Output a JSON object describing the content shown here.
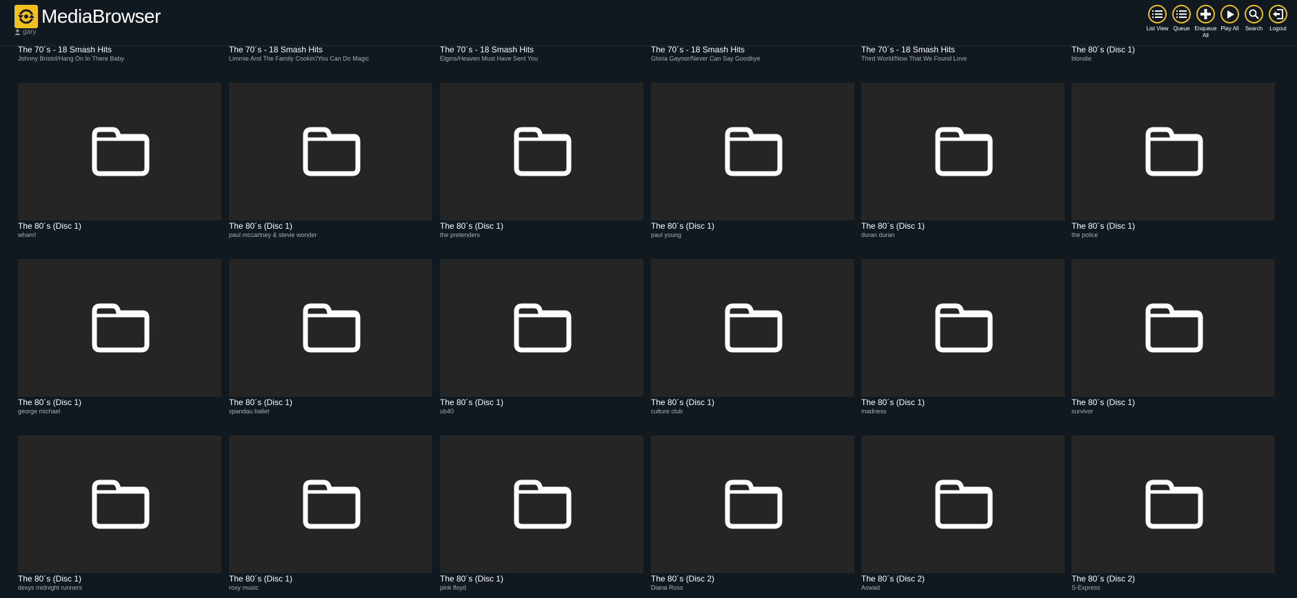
{
  "app": {
    "logo_word1": "Media",
    "logo_word2": "Browser",
    "user": "gary"
  },
  "toolbar": [
    {
      "label": "List View",
      "icon": "list-icon"
    },
    {
      "label": "Queue",
      "icon": "queue-icon"
    },
    {
      "label": "Enqueue All",
      "icon": "plus-icon"
    },
    {
      "label": "Play All",
      "icon": "play-icon"
    },
    {
      "label": "Search",
      "icon": "search-icon"
    },
    {
      "label": "Logout",
      "icon": "logout-icon"
    }
  ],
  "top_row": [
    {
      "title": "The 70´s - 18 Smash Hits",
      "sub": "Johnny Bristol/Hang On In There Baby"
    },
    {
      "title": "The 70´s - 18 Smash Hits",
      "sub": "Limmie And The Family Cookin'/You Can Do Magic"
    },
    {
      "title": "The 70´s - 18 Smash Hits",
      "sub": "Elgins/Heaven Must Have Sent You"
    },
    {
      "title": "The 70´s - 18 Smash Hits",
      "sub": "Gloria Gaynor/Never Can Say Goodbye"
    },
    {
      "title": "The 70´s - 18 Smash Hits",
      "sub": "Third World/Now That We Found Love"
    },
    {
      "title": "The 80´s (Disc 1)",
      "sub": "blondie"
    }
  ],
  "items": [
    {
      "title": "The 80´s (Disc 1)",
      "sub": "wham!"
    },
    {
      "title": "The 80´s (Disc 1)",
      "sub": "paul mccartney & stevie wonder"
    },
    {
      "title": "The 80´s (Disc 1)",
      "sub": "the pretenders"
    },
    {
      "title": "The 80´s (Disc 1)",
      "sub": "paul young"
    },
    {
      "title": "The 80´s (Disc 1)",
      "sub": "duran duran"
    },
    {
      "title": "The 80´s (Disc 1)",
      "sub": "the police"
    },
    {
      "title": "The 80´s (Disc 1)",
      "sub": "george michael"
    },
    {
      "title": "The 80´s (Disc 1)",
      "sub": "spandau ballet"
    },
    {
      "title": "The 80´s (Disc 1)",
      "sub": "ub40"
    },
    {
      "title": "The 80´s (Disc 1)",
      "sub": "culture club"
    },
    {
      "title": "The 80´s (Disc 1)",
      "sub": "madness"
    },
    {
      "title": "The 80´s (Disc 1)",
      "sub": "survivor"
    },
    {
      "title": "The 80´s (Disc 1)",
      "sub": "dexys midnight runners"
    },
    {
      "title": "The 80´s (Disc 1)",
      "sub": "roxy music"
    },
    {
      "title": "The 80´s (Disc 1)",
      "sub": "pink floyd"
    },
    {
      "title": "The 80´s (Disc 2)",
      "sub": "Diana Ross"
    },
    {
      "title": "The 80´s (Disc 2)",
      "sub": "Aswad"
    },
    {
      "title": "The 80´s (Disc 2)",
      "sub": "S-Express"
    }
  ],
  "colors": {
    "accent": "#f0c020",
    "background": "#101820",
    "tile": "#252525"
  }
}
